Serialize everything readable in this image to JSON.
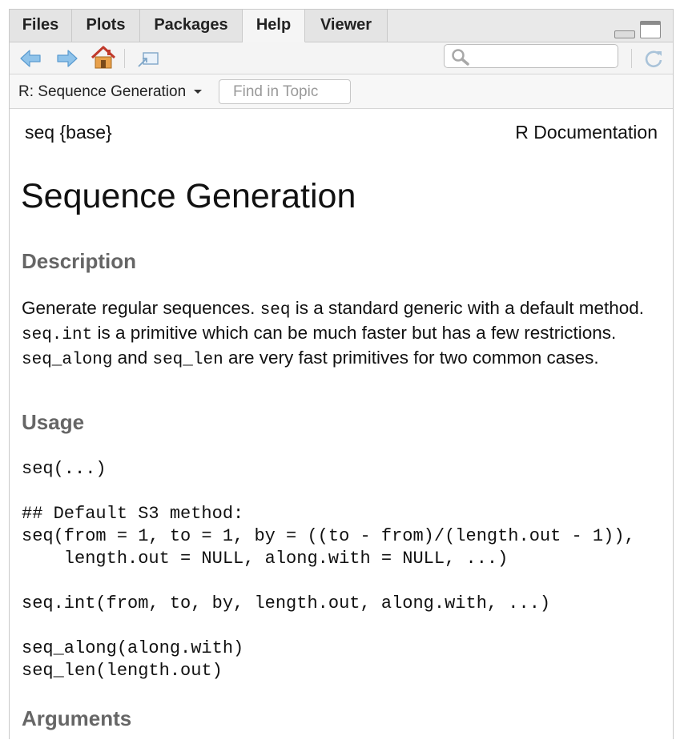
{
  "tabs": [
    {
      "label": "Files"
    },
    {
      "label": "Plots"
    },
    {
      "label": "Packages"
    },
    {
      "label": "Help",
      "active": true
    },
    {
      "label": "Viewer"
    }
  ],
  "toolbar": {
    "icons": [
      "back-arrow-icon",
      "forward-arrow-icon",
      "home-icon",
      "popout-icon",
      "refresh-icon"
    ],
    "search_value": ""
  },
  "topic_bar": {
    "selected_topic": "R: Sequence Generation",
    "find_placeholder": "Find in Topic"
  },
  "doc": {
    "header_left": "seq {base}",
    "header_right": "R Documentation",
    "title": "Sequence Generation",
    "description_heading": "Description",
    "description_parts": [
      "Generate regular sequences. ",
      "seq",
      " is a standard generic with a default method. ",
      "seq.int",
      " is a primitive which can be much faster but has a few restrictions. ",
      "seq_along",
      " and ",
      "seq_len",
      " are very fast primitives for two common cases."
    ],
    "usage_heading": "Usage",
    "usage_code": "seq(...)\n\n## Default S3 method:\nseq(from = 1, to = 1, by = ((to - from)/(length.out - 1)),\n    length.out = NULL, along.with = NULL, ...)\n\nseq.int(from, to, by, length.out, along.with, ...)\n\nseq_along(along.with)\nseq_len(length.out)",
    "arguments_heading": "Arguments"
  }
}
